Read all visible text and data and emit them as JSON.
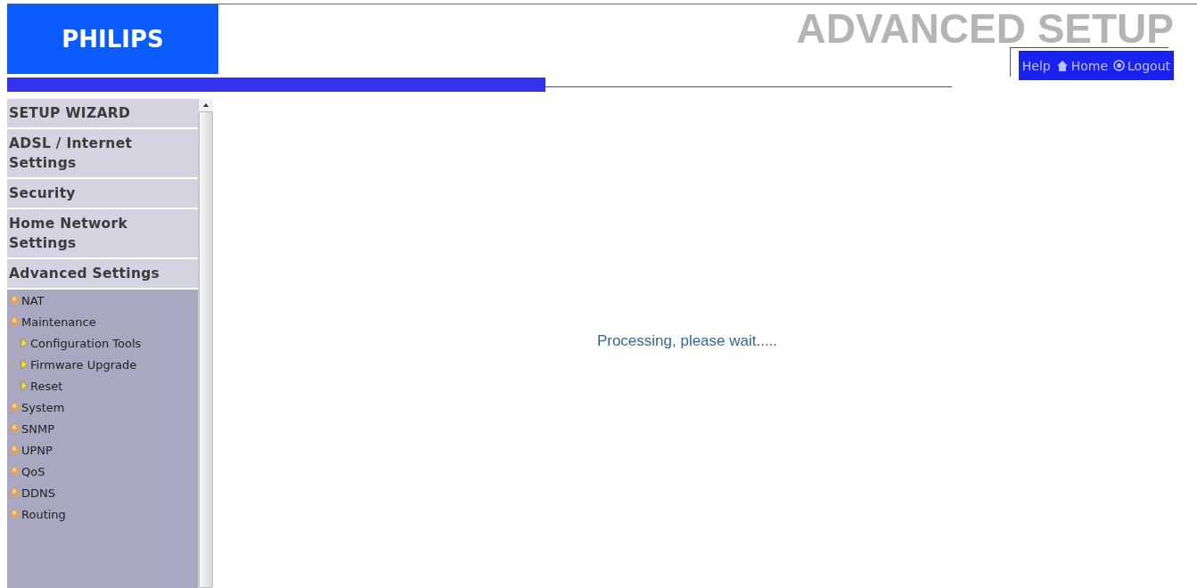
{
  "logo": "PHILIPS",
  "title": "ADVANCED SETUP",
  "header_links": [
    "Help",
    "Home",
    "Logout"
  ],
  "sidebar": {
    "sections": [
      "SETUP WIZARD",
      "ADSL / Internet Settings",
      "Security",
      "Home Network Settings",
      "Advanced Settings"
    ],
    "items": [
      {
        "label": "NAT"
      },
      {
        "label": "Maintenance",
        "children": [
          {
            "label": "Configuration Tools"
          },
          {
            "label": "Firmware Upgrade"
          },
          {
            "label": "Reset"
          }
        ]
      },
      {
        "label": "System"
      },
      {
        "label": "SNMP"
      },
      {
        "label": "UPNP"
      },
      {
        "label": "QoS"
      },
      {
        "label": "DDNS"
      },
      {
        "label": "Routing"
      }
    ]
  },
  "message": "Processing, please wait....."
}
